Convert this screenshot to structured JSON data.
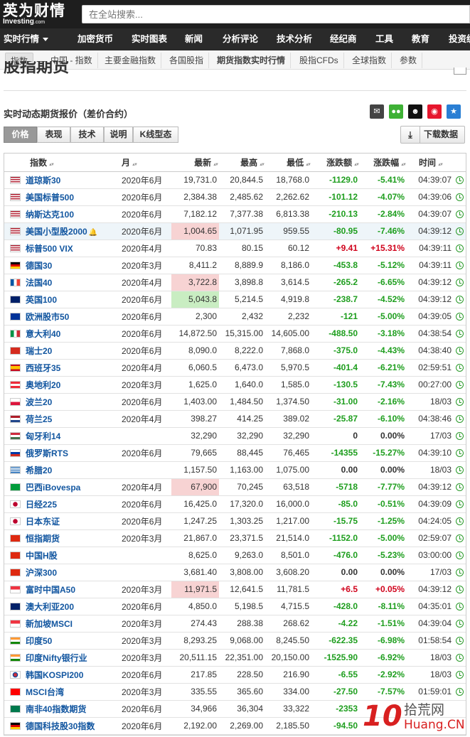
{
  "header": {
    "logo_cn": "英为财情",
    "logo_en": "Investing",
    "logo_suffix": ".com",
    "search_placeholder": "在全站搜索..."
  },
  "main_nav": [
    "实时行情",
    "加密货币",
    "实时图表",
    "新闻",
    "分析评论",
    "技术分析",
    "经纪商",
    "工具",
    "教育",
    "投资统"
  ],
  "sub_nav": [
    "指数",
    "中国 - 指数",
    "主要金融指数",
    "各国股指",
    "期货指数实时行情",
    "股指CFDs",
    "全球指数",
    "参数"
  ],
  "page_title": "股指期货",
  "section_title": "实时动态期货报价（差价合约）",
  "share_icons": [
    "mail-icon",
    "wechat-icon",
    "qq-icon",
    "weibo-icon",
    "favorite-icon"
  ],
  "tabs": [
    "价格",
    "表现",
    "技术",
    "说明",
    "K线型态"
  ],
  "download_label": "下载数据",
  "table": {
    "headers": [
      "指数",
      "月",
      "最新",
      "最高",
      "最低",
      "涨跌额",
      "涨跌幅",
      "时间"
    ],
    "rows": [
      {
        "flag": "us",
        "name": "道琼斯30",
        "month": "2020年6月",
        "last": "19,731.0",
        "high": "20,844.5",
        "low": "18,768.0",
        "chg": "-1129.0",
        "pct": "-5.41%",
        "time": "04:39:07"
      },
      {
        "flag": "us",
        "name": "美国标普500",
        "month": "2020年6月",
        "last": "2,384.38",
        "high": "2,485.62",
        "low": "2,262.62",
        "chg": "-101.12",
        "pct": "-4.07%",
        "time": "04:39:06"
      },
      {
        "flag": "us",
        "name": "纳斯达克100",
        "month": "2020年6月",
        "last": "7,182.12",
        "high": "7,377.38",
        "low": "6,813.38",
        "chg": "-210.13",
        "pct": "-2.84%",
        "time": "04:39:07"
      },
      {
        "flag": "us",
        "name": "美国小型股2000",
        "month": "2020年6月",
        "last": "1,004.65",
        "high": "1,071.95",
        "low": "959.55",
        "chg": "-80.95",
        "pct": "-7.46%",
        "time": "04:39:12",
        "bell": true,
        "hl": true,
        "lastbg": "red"
      },
      {
        "flag": "us",
        "name": "标普500 VIX",
        "month": "2020年4月",
        "last": "70.83",
        "high": "80.15",
        "low": "60.12",
        "chg": "+9.41",
        "pct": "+15.31%",
        "time": "04:39:11"
      },
      {
        "flag": "de",
        "name": "德国30",
        "month": "2020年3月",
        "last": "8,411.2",
        "high": "8,889.9",
        "low": "8,186.0",
        "chg": "-453.8",
        "pct": "-5.12%",
        "time": "04:39:11"
      },
      {
        "flag": "fr",
        "name": "法国40",
        "month": "2020年4月",
        "last": "3,722.8",
        "high": "3,898.8",
        "low": "3,614.5",
        "chg": "-265.2",
        "pct": "-6.65%",
        "time": "04:39:12",
        "lastbg": "red"
      },
      {
        "flag": "uk",
        "name": "英国100",
        "month": "2020年6月",
        "last": "5,043.8",
        "high": "5,214.5",
        "low": "4,919.8",
        "chg": "-238.7",
        "pct": "-4.52%",
        "time": "04:39:12",
        "lastbg": "green"
      },
      {
        "flag": "eu",
        "name": "欧洲股市50",
        "month": "2020年6月",
        "last": "2,300",
        "high": "2,432",
        "low": "2,232",
        "chg": "-121",
        "pct": "-5.00%",
        "time": "04:39:05"
      },
      {
        "flag": "it",
        "name": "意大利40",
        "month": "2020年6月",
        "last": "14,872.50",
        "high": "15,315.00",
        "low": "14,605.00",
        "chg": "-488.50",
        "pct": "-3.18%",
        "time": "04:38:54"
      },
      {
        "flag": "ch",
        "name": "瑞士20",
        "month": "2020年6月",
        "last": "8,090.0",
        "high": "8,222.0",
        "low": "7,868.0",
        "chg": "-375.0",
        "pct": "-4.43%",
        "time": "04:38:40"
      },
      {
        "flag": "es",
        "name": "西班牙35",
        "month": "2020年4月",
        "last": "6,060.5",
        "high": "6,473.0",
        "low": "5,970.5",
        "chg": "-401.4",
        "pct": "-6.21%",
        "time": "02:59:51"
      },
      {
        "flag": "at",
        "name": "奥地利20",
        "month": "2020年3月",
        "last": "1,625.0",
        "high": "1,640.0",
        "low": "1,585.0",
        "chg": "-130.5",
        "pct": "-7.43%",
        "time": "00:27:00"
      },
      {
        "flag": "pl",
        "name": "波兰20",
        "month": "2020年6月",
        "last": "1,403.00",
        "high": "1,484.50",
        "low": "1,374.50",
        "chg": "-31.00",
        "pct": "-2.16%",
        "time": "18/03"
      },
      {
        "flag": "nl",
        "name": "荷兰25",
        "month": "2020年4月",
        "last": "398.27",
        "high": "414.25",
        "low": "389.02",
        "chg": "-25.87",
        "pct": "-6.10%",
        "time": "04:38:46"
      },
      {
        "flag": "hu",
        "name": "匈牙利14",
        "month": "",
        "last": "32,290",
        "high": "32,290",
        "low": "32,290",
        "chg": "0",
        "pct": "0.00%",
        "time": "17/03"
      },
      {
        "flag": "ru",
        "name": "俄罗斯RTS",
        "month": "2020年6月",
        "last": "79,665",
        "high": "88,445",
        "low": "76,465",
        "chg": "-14355",
        "pct": "-15.27%",
        "time": "04:39:10"
      },
      {
        "flag": "gr",
        "name": "希腊20",
        "month": "",
        "last": "1,157.50",
        "high": "1,163.00",
        "low": "1,075.00",
        "chg": "0.00",
        "pct": "0.00%",
        "time": "18/03"
      },
      {
        "flag": "br",
        "name": "巴西iBovespa",
        "month": "2020年4月",
        "last": "67,900",
        "high": "70,245",
        "low": "63,518",
        "chg": "-5718",
        "pct": "-7.77%",
        "time": "04:39:12",
        "lastbg": "red"
      },
      {
        "flag": "jp",
        "name": "日经225",
        "month": "2020年6月",
        "last": "16,425.0",
        "high": "17,320.0",
        "low": "16,000.0",
        "chg": "-85.0",
        "pct": "-0.51%",
        "time": "04:39:09"
      },
      {
        "flag": "jp",
        "name": "日本东证",
        "month": "2020年6月",
        "last": "1,247.25",
        "high": "1,303.25",
        "low": "1,217.00",
        "chg": "-15.75",
        "pct": "-1.25%",
        "time": "04:24:05"
      },
      {
        "flag": "hk",
        "name": "恒指期货",
        "month": "2020年3月",
        "last": "21,867.0",
        "high": "23,371.5",
        "low": "21,514.0",
        "chg": "-1152.0",
        "pct": "-5.00%",
        "time": "02:59:07"
      },
      {
        "flag": "hk",
        "name": "中国H股",
        "month": "",
        "last": "8,625.0",
        "high": "9,263.0",
        "low": "8,501.0",
        "chg": "-476.0",
        "pct": "-5.23%",
        "time": "03:00:00"
      },
      {
        "flag": "cn",
        "name": "沪深300",
        "month": "",
        "last": "3,681.40",
        "high": "3,808.00",
        "low": "3,608.20",
        "chg": "0.00",
        "pct": "0.00%",
        "time": "17/03"
      },
      {
        "flag": "sg",
        "name": "富时中国A50",
        "month": "2020年3月",
        "last": "11,971.5",
        "high": "12,641.5",
        "low": "11,781.5",
        "chg": "+6.5",
        "pct": "+0.05%",
        "time": "04:39:12",
        "lastbg": "red"
      },
      {
        "flag": "au",
        "name": "澳大利亚200",
        "month": "2020年6月",
        "last": "4,850.0",
        "high": "5,198.5",
        "low": "4,715.5",
        "chg": "-428.0",
        "pct": "-8.11%",
        "time": "04:35:01"
      },
      {
        "flag": "sg",
        "name": "新加坡MSCI",
        "month": "2020年3月",
        "last": "274.43",
        "high": "288.38",
        "low": "268.62",
        "chg": "-4.22",
        "pct": "-1.51%",
        "time": "04:39:04"
      },
      {
        "flag": "in",
        "name": "印度50",
        "month": "2020年3月",
        "last": "8,293.25",
        "high": "9,068.00",
        "low": "8,245.50",
        "chg": "-622.35",
        "pct": "-6.98%",
        "time": "01:58:54"
      },
      {
        "flag": "in",
        "name": "印度Nifty银行业",
        "month": "2020年3月",
        "last": "20,511.15",
        "high": "22,351.00",
        "low": "20,150.00",
        "chg": "-1525.90",
        "pct": "-6.92%",
        "time": "18/03"
      },
      {
        "flag": "kr",
        "name": "韩国KOSPI200",
        "month": "2020年6月",
        "last": "217.85",
        "high": "228.50",
        "low": "216.90",
        "chg": "-6.55",
        "pct": "-2.92%",
        "time": "18/03"
      },
      {
        "flag": "tw",
        "name": "MSCI台湾",
        "month": "2020年3月",
        "last": "335.55",
        "high": "365.60",
        "low": "334.00",
        "chg": "-27.50",
        "pct": "-7.57%",
        "time": "01:59:01"
      },
      {
        "flag": "za",
        "name": "南非40指数期货",
        "month": "2020年6月",
        "last": "34,966",
        "high": "36,304",
        "low": "33,322",
        "chg": "-2353",
        "pct": "",
        "time": ""
      },
      {
        "flag": "de",
        "name": "德国科技股30指数",
        "month": "2020年6月",
        "last": "2,192.00",
        "high": "2,269.00",
        "low": "2,185.50",
        "chg": "-94.50",
        "pct": "",
        "time": ""
      }
    ]
  },
  "watermark": {
    "num": "10",
    "text1": "拾荒网",
    "text2": "Huang.CN"
  }
}
